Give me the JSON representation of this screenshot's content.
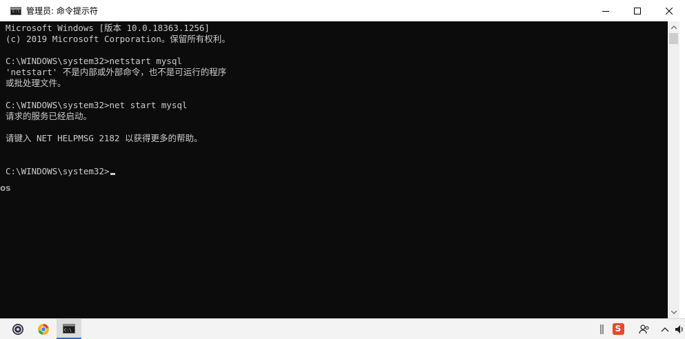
{
  "window": {
    "title": "管理员: 命令提示符",
    "controls": {
      "minimize_icon": "minimize-icon",
      "maximize_icon": "maximize-icon",
      "close_icon": "close-icon"
    }
  },
  "console": {
    "lines": [
      "Microsoft Windows [版本 10.0.18363.1256]",
      "(c) 2019 Microsoft Corporation。保留所有权利。",
      "",
      "C:\\WINDOWS\\system32>netstart mysql",
      "'netstart' 不是内部或外部命令，也不是可运行的程序",
      "或批处理文件。",
      "",
      "C:\\WINDOWS\\system32>net start mysql",
      "请求的服务已经启动。",
      "",
      "请键入 NET HELPMSG 2182 以获得更多的帮助。",
      "",
      "",
      "C:\\WINDOWS\\system32>"
    ],
    "text_color": "#cccccc",
    "background": "#0c0c0c"
  },
  "background_window": {
    "edge_text": "os"
  },
  "taskbar": {
    "apps": [
      {
        "name": "obs-icon"
      },
      {
        "name": "browser-icon"
      },
      {
        "name": "cmd-icon"
      }
    ],
    "tray": {
      "divider_icon": "tray-divider-icon",
      "ime_label": "S",
      "ime_color": "#e8492e",
      "people_icon": "people-icon",
      "chevron_icon": "chevron-up-icon",
      "speaker_icon": "speaker-icon"
    }
  }
}
